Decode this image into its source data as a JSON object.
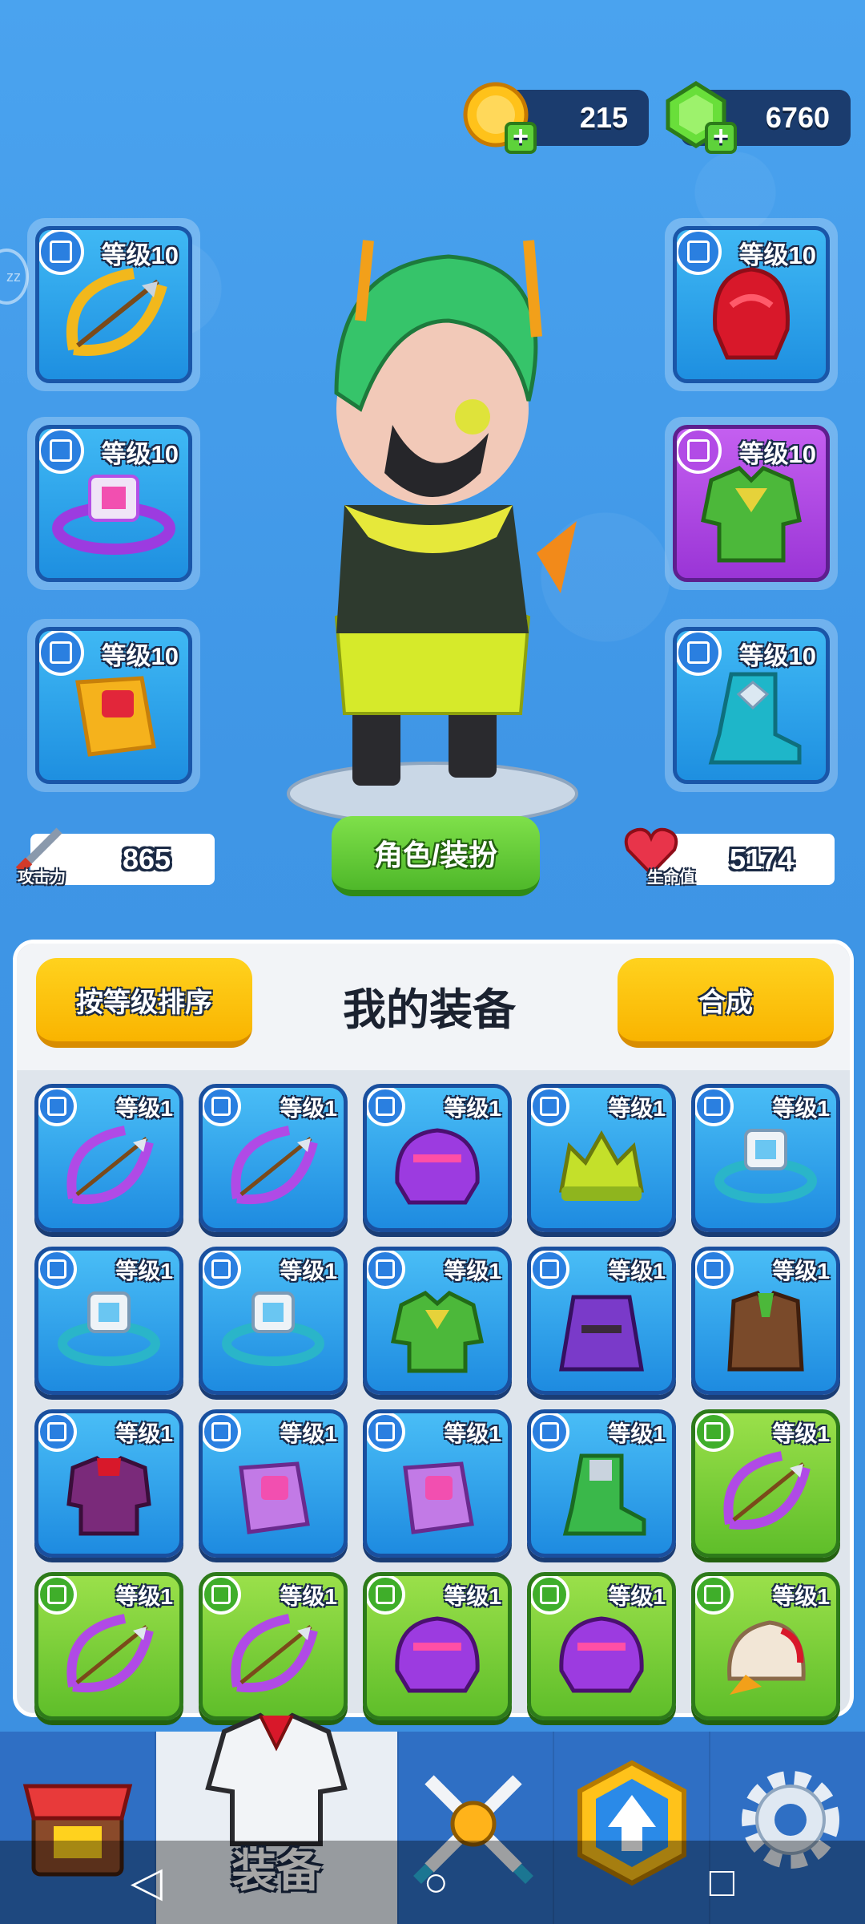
{
  "currency": {
    "gold": "215",
    "gems": "6760",
    "gold_color": "#ffc21a",
    "gem_color": "#5ed23a"
  },
  "side_tab": "zz",
  "left_slots": [
    {
      "level": "等级10",
      "icon": "bow-icon",
      "type": "weapon"
    },
    {
      "level": "等级10",
      "icon": "ring-icon",
      "type": "ring"
    },
    {
      "level": "等级10",
      "icon": "bracer-icon",
      "type": "bracer"
    }
  ],
  "right_slots": [
    {
      "level": "等级10",
      "icon": "helmet-icon",
      "type": "helmet"
    },
    {
      "level": "等级10",
      "icon": "armor-icon",
      "type": "armor",
      "rarity": "epic"
    },
    {
      "level": "等级10",
      "icon": "boot-icon",
      "type": "boots"
    }
  ],
  "stats": {
    "attack_label": "攻击力",
    "attack_value": "865",
    "hp_label": "生命值",
    "hp_value": "5174"
  },
  "role_button": "角色/装扮",
  "panel": {
    "sort_button": "按等级排序",
    "title": "我的装备",
    "merge_button": "合成"
  },
  "items": [
    {
      "level": "等级1",
      "icon": "bow-icon",
      "rarity": "blue"
    },
    {
      "level": "等级1",
      "icon": "bow-icon",
      "rarity": "blue"
    },
    {
      "level": "等级1",
      "icon": "helmet-icon",
      "rarity": "blue"
    },
    {
      "level": "等级1",
      "icon": "crown-helmet-icon",
      "rarity": "blue"
    },
    {
      "level": "等级1",
      "icon": "ring-icon",
      "rarity": "blue"
    },
    {
      "level": "等级1",
      "icon": "ring-icon",
      "rarity": "blue"
    },
    {
      "level": "等级1",
      "icon": "ring-icon",
      "rarity": "blue"
    },
    {
      "level": "等级1",
      "icon": "armor-icon",
      "rarity": "blue"
    },
    {
      "level": "等级1",
      "icon": "cloak-icon",
      "rarity": "blue"
    },
    {
      "level": "等级1",
      "icon": "vest-icon",
      "rarity": "blue"
    },
    {
      "level": "等级1",
      "icon": "shirt-icon",
      "rarity": "blue"
    },
    {
      "level": "等级1",
      "icon": "bracer-icon",
      "rarity": "blue"
    },
    {
      "level": "等级1",
      "icon": "bracer-icon",
      "rarity": "blue"
    },
    {
      "level": "等级1",
      "icon": "boot-icon",
      "rarity": "blue"
    },
    {
      "level": "等级1",
      "icon": "bow-icon",
      "rarity": "green"
    },
    {
      "level": "等级1",
      "icon": "bow-icon",
      "rarity": "green"
    },
    {
      "level": "等级1",
      "icon": "bow-icon",
      "rarity": "green"
    },
    {
      "level": "等级1",
      "icon": "helmet-icon",
      "rarity": "green"
    },
    {
      "level": "等级1",
      "icon": "helmet-icon",
      "rarity": "green"
    },
    {
      "level": "等级1",
      "icon": "eagle-helmet-icon",
      "rarity": "green"
    }
  ],
  "nav": {
    "shop": "shop-icon",
    "equipment_label": "装备",
    "battle": "crossed-swords-icon",
    "upgrade": "upgrade-icon",
    "settings": "gear-icon"
  },
  "system_bar": {
    "back": "◁",
    "home": "○",
    "recent": "□"
  }
}
